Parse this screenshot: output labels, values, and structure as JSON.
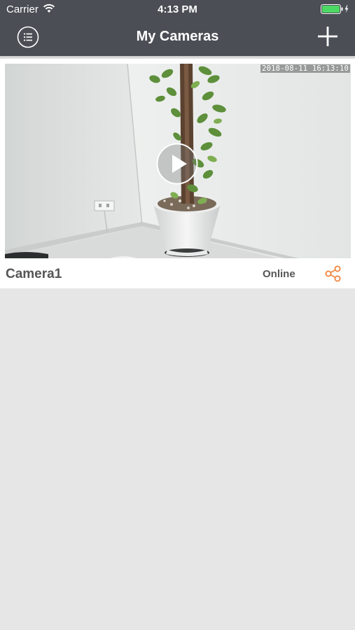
{
  "status_bar": {
    "carrier": "Carrier",
    "time": "4:13 PM"
  },
  "nav": {
    "title": "My Cameras",
    "menu_icon": "list-icon",
    "add_icon": "plus-icon"
  },
  "cameras": [
    {
      "name": "Camera1",
      "status": "Online",
      "timestamp": "2018-08-11 16:13:10",
      "play_icon": "play-icon",
      "share_icon": "share-icon"
    }
  ],
  "colors": {
    "header_bg": "#4b4e55",
    "page_bg": "#e6e6e6",
    "battery": "#4cd964",
    "share_accent": "#f0843c"
  }
}
